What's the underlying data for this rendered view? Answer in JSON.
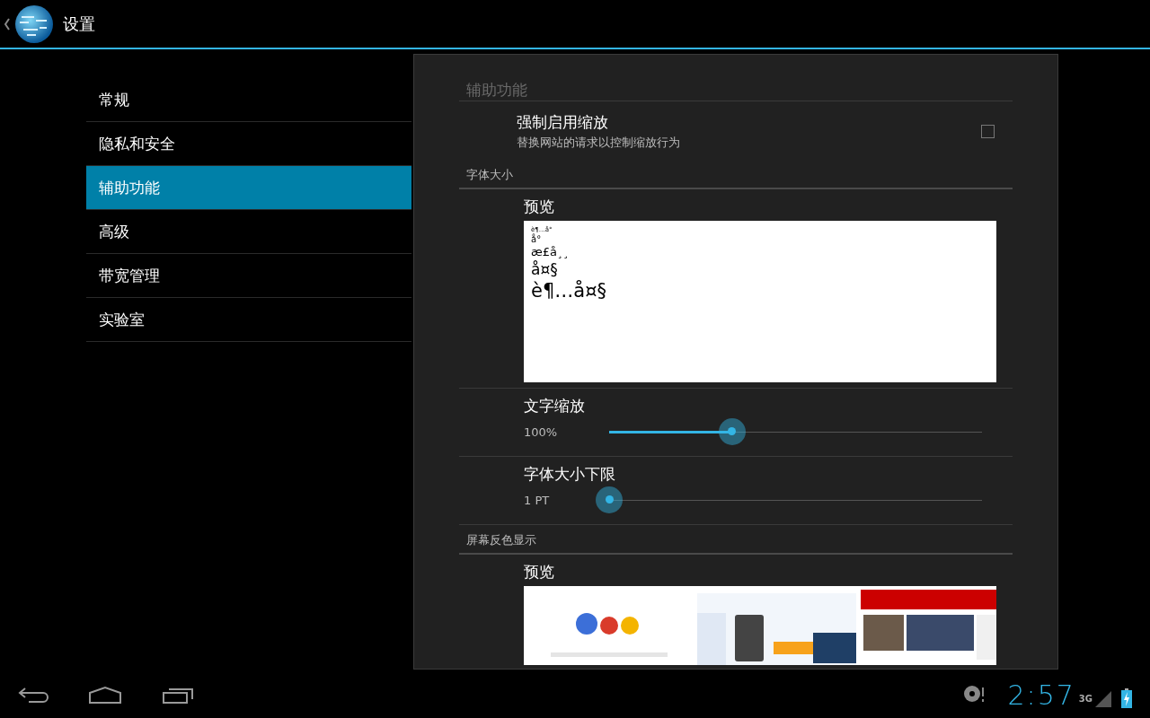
{
  "action_bar": {
    "title": "设置"
  },
  "sidebar": {
    "items": [
      {
        "label": "常规",
        "selected": false
      },
      {
        "label": "隐私和安全",
        "selected": false
      },
      {
        "label": "辅助功能",
        "selected": true
      },
      {
        "label": "高级",
        "selected": false
      },
      {
        "label": "带宽管理",
        "selected": false
      },
      {
        "label": "实验室",
        "selected": false
      }
    ]
  },
  "panel": {
    "title": "辅助功能",
    "items": [
      {
        "kind": "checkbox",
        "title": "强制启用缩放",
        "summary": "替换网站的请求以控制缩放行为",
        "checked": false
      },
      {
        "kind": "header",
        "label": "字体大小"
      },
      {
        "kind": "font_preview",
        "title": "预览",
        "lines": [
          "è¶…å°",
          "å°",
          "æ£å¸¸",
          "å¤§",
          "è¶…å¤§"
        ]
      },
      {
        "kind": "slider",
        "title": "文字缩放",
        "reading": "100%",
        "level": 0.33
      },
      {
        "kind": "slider",
        "title": "字体大小下限",
        "reading": "1 PT",
        "level": 0
      },
      {
        "kind": "header",
        "label": "屏幕反色显示"
      },
      {
        "kind": "picture_preview",
        "title": "预览"
      }
    ]
  },
  "nav_bar": {
    "time": "2:57",
    "network": "3G"
  }
}
